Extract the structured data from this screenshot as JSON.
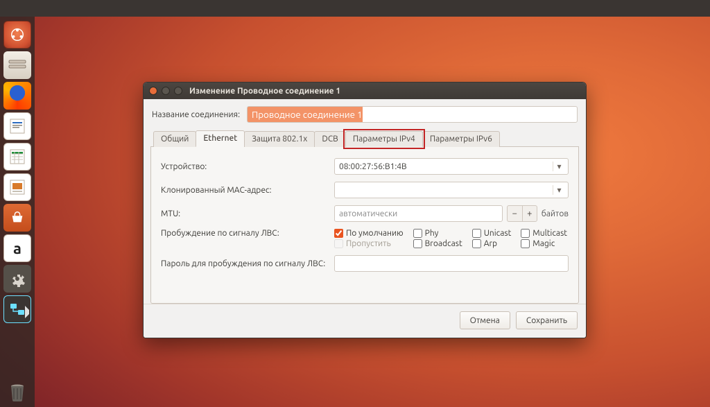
{
  "window": {
    "title": "Изменение Проводное соединение 1"
  },
  "name_row": {
    "label": "Название соединения:",
    "value": "Проводное соединение 1"
  },
  "tabs": {
    "general": "Общий",
    "ethernet": "Ethernet",
    "dot1x": "Защита 802.1x",
    "dcb": "DCB",
    "ipv4": "Параметры IPv4",
    "ipv6": "Параметры IPv6",
    "active": "ethernet",
    "highlighted": "ipv4"
  },
  "ethernet": {
    "device_label": "Устройство:",
    "device_value": "08:00:27:56:B1:4B",
    "cloned_mac_label": "Клонированный MAC-адрес:",
    "cloned_mac_value": "",
    "mtu_label": "MTU:",
    "mtu_value": "автоматически",
    "mtu_unit": "байтов",
    "wol_label": "Пробуждение по сигналу ЛВС:",
    "wol": {
      "default": "По умолчанию",
      "ignore": "Пропустить",
      "phy": "Phy",
      "broadcast": "Broadcast",
      "unicast": "Unicast",
      "arp": "Arp",
      "multicast": "Multicast",
      "magic": "Magic",
      "default_checked": true
    },
    "wol_password_label": "Пароль для пробуждения по сигналу ЛВС:",
    "wol_password_value": ""
  },
  "buttons": {
    "cancel": "Отмена",
    "save": "Сохранить"
  },
  "launcher": {
    "dash": "dash",
    "files": "files",
    "firefox": "firefox",
    "writer": "writer",
    "calc": "calc",
    "impress": "impress",
    "software": "software-center",
    "amazon": "amazon",
    "settings": "system-settings",
    "network": "network-manager",
    "trash": "trash"
  }
}
